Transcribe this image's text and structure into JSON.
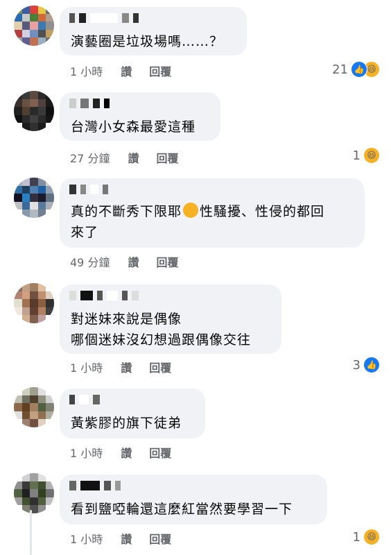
{
  "comments": [
    {
      "lines": [
        "演藝圈是垃圾場嗎……？"
      ],
      "time": "1 小時",
      "like": "讚",
      "reply": "回覆",
      "count": "21",
      "reactions": [
        "like-icon",
        "haha-icon"
      ]
    },
    {
      "lines": [
        "台灣小女森最愛這種"
      ],
      "time": "27 分鐘",
      "like": "讚",
      "reply": "回覆",
      "count": "1",
      "reactions": [
        "haha-icon"
      ]
    },
    {
      "lines": [
        "真的不斷秀下限耶",
        "性騷擾、性侵的都回",
        "來了"
      ],
      "time": "49 分鐘",
      "like": "讚",
      "reply": "回覆",
      "count": "",
      "reactions": []
    },
    {
      "lines": [
        "對迷妹來說是偶像",
        "哪個迷妹沒幻想過跟偶像交往"
      ],
      "time": "1 小時",
      "like": "讚",
      "reply": "回覆",
      "count": "3",
      "reactions": [
        "like-icon"
      ]
    },
    {
      "lines": [
        "黃紫膠的旗下徒弟"
      ],
      "time": "1 小時",
      "like": "讚",
      "reply": "回覆",
      "count": "",
      "reactions": []
    },
    {
      "lines": [
        "看到鹽啞輪還這麼紅當然要學習一下"
      ],
      "time": "1 小時",
      "like": "讚",
      "reply": "回覆",
      "count": "1",
      "reactions": [
        "haha-icon"
      ]
    }
  ],
  "colors": {
    "bubble": "#f0f2f5",
    "meta": "#65676b",
    "like": "#1877f2",
    "haha": "#f7b125"
  }
}
